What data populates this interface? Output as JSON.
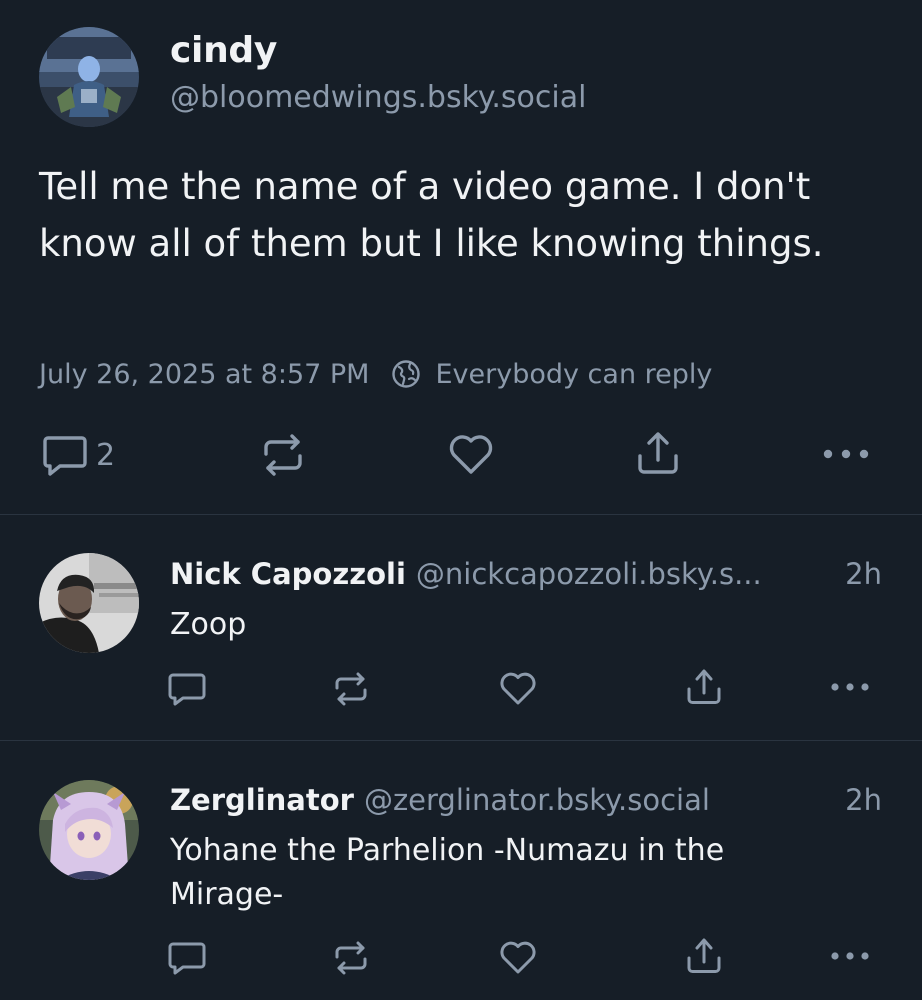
{
  "main_post": {
    "author_name": "cindy",
    "author_handle": "@bloomedwings.bsky.social",
    "text": "Tell me the name of a video game. I don't know all of them but I like knowing things.",
    "timestamp": "July 26, 2025 at 8:57 PM",
    "reply_setting": "Everybody can reply",
    "reply_count": "2",
    "icons": [
      "reply-icon",
      "repost-icon",
      "like-icon",
      "share-icon",
      "more-icon"
    ]
  },
  "replies": [
    {
      "author_name": "Nick Capozzoli",
      "author_handle": "@nickcapozzoli.bsky.s...",
      "time": "2h",
      "text": "Zoop"
    },
    {
      "author_name": "Zerglinator",
      "author_handle": "@zerglinator.bsky.social",
      "time": "2h",
      "text": "Yohane the Parhelion -Numazu in the Mirage-"
    }
  ],
  "colors": {
    "background": "#161e27",
    "text_primary": "#f1f3f5",
    "text_secondary": "#8c9aab",
    "divider": "#2a3440"
  }
}
